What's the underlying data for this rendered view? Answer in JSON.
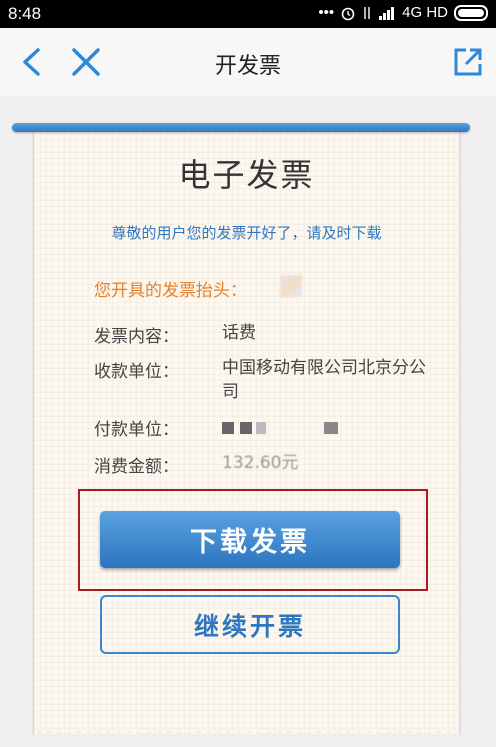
{
  "status_bar": {
    "time": "8:48",
    "network": "4G HD",
    "dots": "•••"
  },
  "nav": {
    "title": "开发票"
  },
  "card": {
    "title": "电子发票",
    "subtitle": "尊敬的用户您的发票开好了，请及时下载",
    "header_label": "您开具的发票抬头：",
    "rows": [
      {
        "label": "发票内容：",
        "value": "话费"
      },
      {
        "label": "收款单位：",
        "value": "中国移动有限公司北京分公司"
      },
      {
        "label": "付款单位：",
        "value": ""
      },
      {
        "label": "消费金额：",
        "value": "132.60元"
      }
    ]
  },
  "buttons": {
    "download": "下载发票",
    "continue": "继续开票"
  },
  "colors": {
    "accent": "#2e78c2",
    "orange": "#e8812c",
    "highlight": "#a51d22"
  }
}
